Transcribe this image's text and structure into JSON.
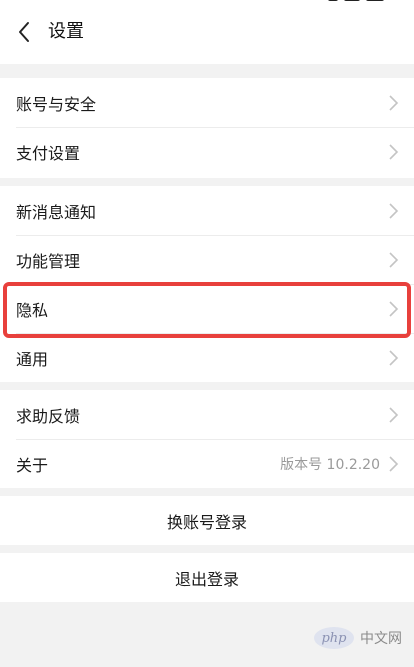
{
  "header": {
    "title": "设置"
  },
  "groups": [
    {
      "items": [
        {
          "label": "账号与安全"
        },
        {
          "label": "支付设置"
        }
      ]
    },
    {
      "items": [
        {
          "label": "新消息通知"
        },
        {
          "label": "功能管理"
        },
        {
          "label": "隐私"
        },
        {
          "label": "通用"
        }
      ]
    },
    {
      "items": [
        {
          "label": "求助反馈"
        },
        {
          "label": "关于",
          "value": "版本号 10.2.20"
        }
      ]
    }
  ],
  "actions": {
    "switch_account": "换账号登录",
    "logout": "退出登录"
  },
  "watermark": {
    "badge": "php",
    "text": "中文网"
  },
  "colors": {
    "highlight": "#e8403c",
    "background": "#f2f2f2"
  },
  "icons": {
    "back": "chevron-left-icon",
    "row": "chevron-right-icon"
  }
}
